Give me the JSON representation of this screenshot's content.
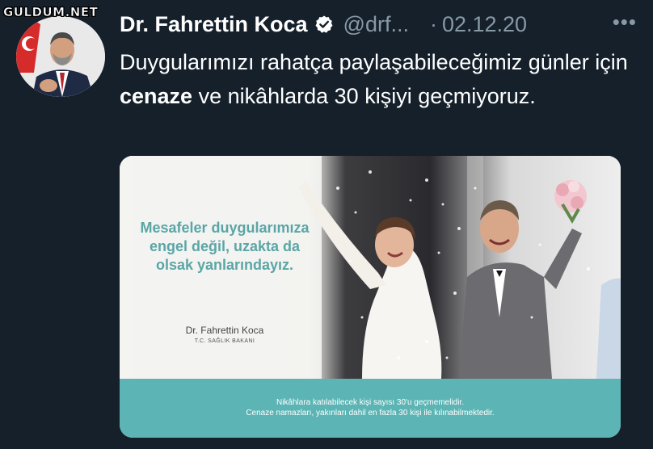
{
  "watermark": "GULDUM.NET",
  "tweet": {
    "author_name": "Dr. Fahrettin Koca",
    "handle": "@drf...",
    "separator": "·",
    "date": "02.12.20",
    "more": "•••",
    "text_part1": "Duygularımızı rahatça paylaşabileceğimiz günler için ",
    "text_bold": "cenaze",
    "text_part2": " ve nikâhlarda 30 kişiyi geçmiyoruz."
  },
  "card": {
    "headline": "Mesafeler duygularımıza engel değil, uzakta da olsak yanlarındayız.",
    "signature_name": "Dr. Fahrettin Koca",
    "signature_title": "T.C. SAĞLIK BAKANI",
    "footer_line1": "Nikâhlara katılabilecek kişi sayısı 30'u geçmemelidir.",
    "footer_line2": "Cenaze namazları, yakınları dahil en fazla 30 kişi ile kılınabilmektedir."
  },
  "colors": {
    "background": "#15202b",
    "muted_text": "#8899a6",
    "teal": "#5cb4b4",
    "verified_badge": "#ffffff"
  }
}
